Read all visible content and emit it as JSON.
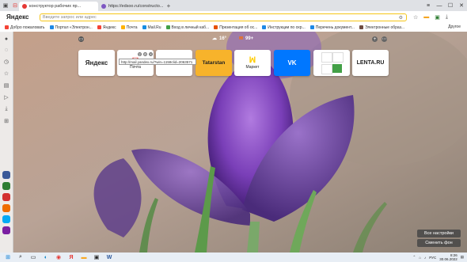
{
  "titlebar": {
    "tabs": [
      {
        "label": "конструктор рабочих пр...",
        "color": "#e53935",
        "active": true
      },
      {
        "label": "https://edsoo.ru/constructo...",
        "color": "#7e57c2",
        "active": false
      }
    ],
    "new_tab_symbol": "+",
    "win_controls": [
      "▬",
      "◻",
      "✕",
      "⎯",
      "▢",
      "✕"
    ]
  },
  "addressbar": {
    "logo": "Яндекс",
    "placeholder": "Введите запрос или адрес"
  },
  "bookmarks": {
    "items": [
      {
        "label": "Добро пожаловать",
        "color": "#f44336"
      },
      {
        "label": "Портал «Электрон...",
        "color": "#1e88e5"
      },
      {
        "label": "Яндекс",
        "color": "#f44336"
      },
      {
        "label": "Почта",
        "color": "#ffb300"
      },
      {
        "label": "Mail.Ru",
        "color": "#168de2"
      },
      {
        "label": "Вход в личный каб...",
        "color": "#43a047"
      },
      {
        "label": "Презентация об ос...",
        "color": "#e65100"
      },
      {
        "label": "Инструкции по охр...",
        "color": "#1e88e5"
      },
      {
        "label": "Перечень документ...",
        "color": "#1e88e5"
      },
      {
        "label": "Электронные образ...",
        "color": "#6d4c41"
      }
    ],
    "other": "Другое"
  },
  "newtab": {
    "weather": "16°",
    "mail_count": "99+",
    "tooltip": "http://mail.yandex.ru/?win=1158clid=2063571",
    "tiles": [
      {
        "label": "",
        "big": "Яндекс",
        "bigcolor": "#000000",
        "bg": "#ffffff"
      },
      {
        "label": "Почта",
        "big": "",
        "bigcolor": "#000000",
        "bg": "#ffffff"
      },
      {
        "label": "",
        "big": "",
        "bigcolor": "#000000",
        "bg": "#ffffff"
      },
      {
        "label": "",
        "big": "Tatarstan",
        "bigcolor": "#222222",
        "bg": "#f7b32b"
      },
      {
        "label": "Маркет",
        "big": "",
        "bigcolor": "#222222",
        "bg": "#ffffff"
      },
      {
        "label": "",
        "big": "VK",
        "bigcolor": "#ffffff",
        "bg": "#0077ff"
      },
      {
        "label": "",
        "big": "",
        "bigcolor": "#222222",
        "bg": "#ffffff"
      },
      {
        "label": "",
        "big": "LENTA.RU",
        "bigcolor": "#000000",
        "bg": "#ffffff"
      }
    ],
    "settings_button": "Все настройки",
    "change_bg_button": "Сменить фон"
  },
  "taskbar": {
    "lang": "РУС",
    "time": "8:26",
    "date": "30.06.2022"
  }
}
